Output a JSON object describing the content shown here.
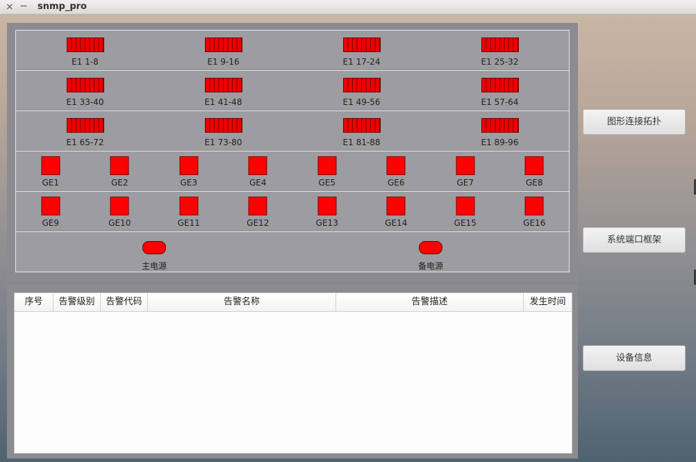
{
  "window": {
    "title": "snmp_pro",
    "close_glyph": "×",
    "min_glyph": "−"
  },
  "ports": {
    "e1_rows": [
      [
        "E1 1-8",
        "E1 9-16",
        "E1 17-24",
        "E1 25-32"
      ],
      [
        "E1 33-40",
        "E1 41-48",
        "E1 49-56",
        "E1 57-64"
      ],
      [
        "E1 65-72",
        "E1 73-80",
        "E1 81-88",
        "E1 89-96"
      ]
    ],
    "ge_rows": [
      [
        "GE1",
        "GE2",
        "GE3",
        "GE4",
        "GE5",
        "GE6",
        "GE7",
        "GE8"
      ],
      [
        "GE9",
        "GE10",
        "GE11",
        "GE12",
        "GE13",
        "GE14",
        "GE15",
        "GE16"
      ]
    ],
    "power": [
      "主电源",
      "备电源"
    ],
    "status_color": "#ff0000"
  },
  "alarm_table": {
    "columns": [
      "序号",
      "告警级别",
      "告警代码",
      "告警名称",
      "告警描述",
      "发生时间"
    ],
    "rows": []
  },
  "side_buttons": {
    "topology": "图形连接拓扑",
    "port_frame": "系统端口框架",
    "device_info": "设备信息"
  }
}
